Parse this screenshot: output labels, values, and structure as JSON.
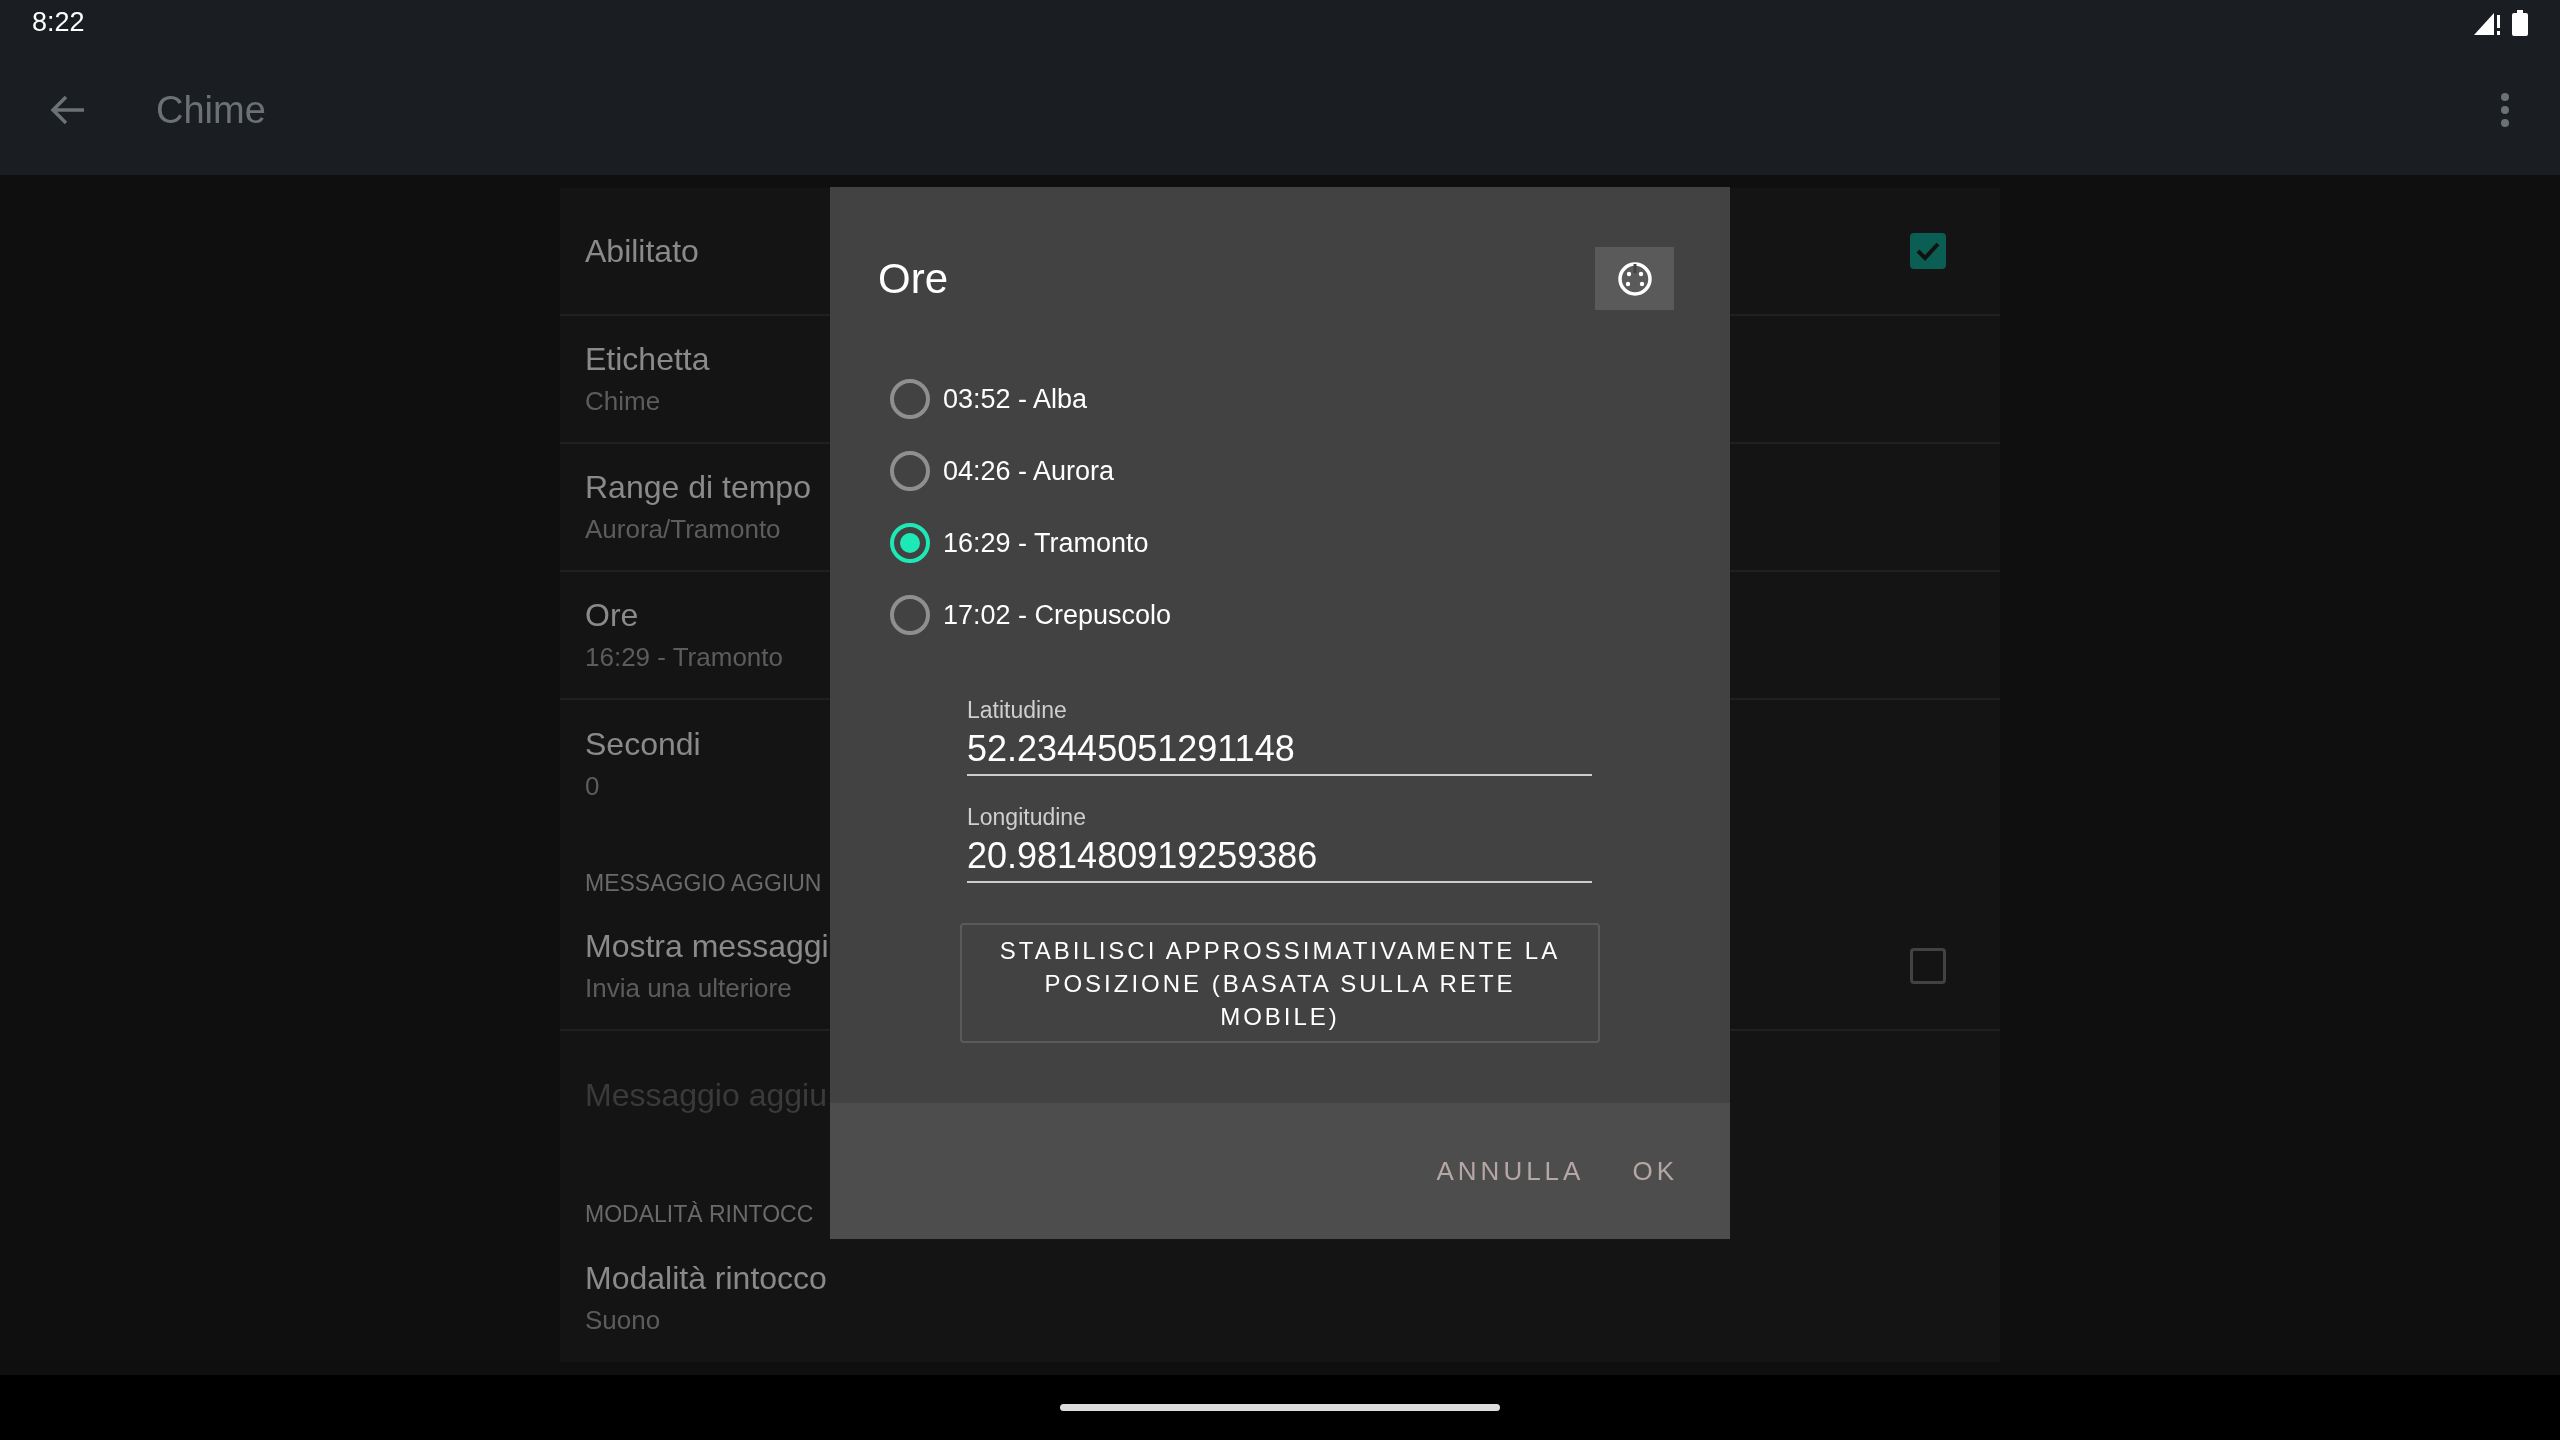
{
  "status_bar": {
    "time": "8:22"
  },
  "app_bar": {
    "title": "Chime"
  },
  "preferences": [
    {
      "kind": "toggle",
      "title": "Abilitato",
      "checked": true,
      "disabled": false
    },
    {
      "kind": "item",
      "title": "Etichetta",
      "summary": "Chime",
      "disabled": false
    },
    {
      "kind": "item",
      "title": "Range di tempo",
      "summary": "Aurora/Tramonto",
      "disabled": false
    },
    {
      "kind": "item",
      "title": "Ore",
      "summary": "16:29 - Tramonto",
      "disabled": false
    },
    {
      "kind": "item",
      "title": "Secondi",
      "summary": "0",
      "disabled": false
    },
    {
      "kind": "category",
      "title": "MESSAGGIO AGGIUN"
    },
    {
      "kind": "toggle",
      "title": "Mostra messaggi",
      "summary": "Invia una ulteriore",
      "checked": false,
      "disabled": false
    },
    {
      "kind": "item",
      "title": "Messaggio aggiu",
      "disabled": true
    },
    {
      "kind": "category",
      "title": "MODALITÀ RINTOCC"
    },
    {
      "kind": "item",
      "title": "Modalità rintocco",
      "summary": "Suono",
      "disabled": false
    }
  ],
  "dialog": {
    "title": "Ore",
    "options": [
      {
        "label": "03:52 - Alba",
        "selected": false
      },
      {
        "label": "04:26 - Aurora",
        "selected": false
      },
      {
        "label": "16:29 - Tramonto",
        "selected": true
      },
      {
        "label": "17:02 - Crepuscolo",
        "selected": false
      }
    ],
    "fields": [
      {
        "label": "Latitudine",
        "value": "52.23445051291148"
      },
      {
        "label": "Longitudine",
        "value": "20.981480919259386"
      }
    ],
    "locate_button": "STABILISCI APPROSSIMATIVAMENTE LA POSIZIONE (BASATA SULLA RETE MOBILE)",
    "buttons": [
      "ANNULLA",
      "OK"
    ]
  }
}
